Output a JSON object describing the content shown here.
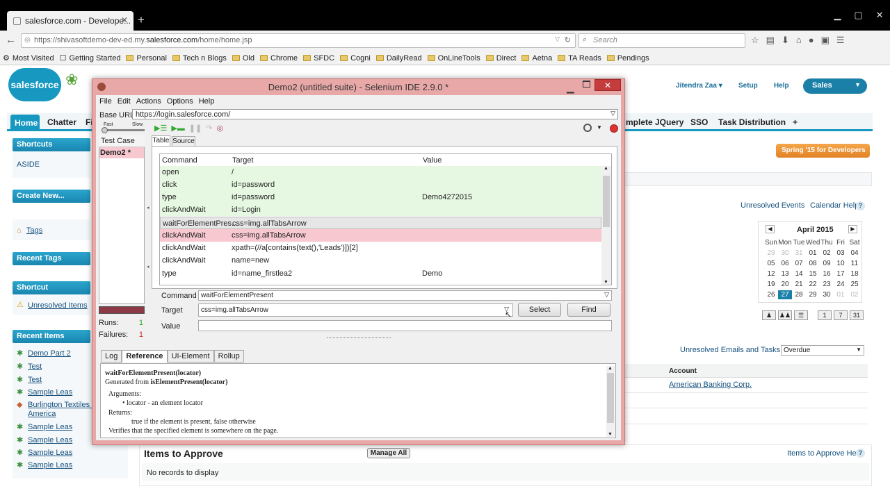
{
  "browser": {
    "tab_title": "salesforce.com - Develope...",
    "tab_close": "✕",
    "new_tab": "+",
    "url_prefix": "https://shivasoftdemo-dev-ed.my.",
    "url_domain": "salesforce.com",
    "url_suffix": "/home/home.jsp",
    "search_placeholder": "Search",
    "bookmarks": [
      "Most Visited",
      "Getting Started",
      "Personal",
      "Tech n Blogs",
      "Old",
      "Chrome",
      "SFDC",
      "Cogni",
      "DailyRead",
      "OnLineTools",
      "Direct",
      "Aetna",
      "TA Reads",
      "Pendings"
    ]
  },
  "salesforce": {
    "logo": "salesforce",
    "user_menu": "Jitendra Zaa",
    "setup": "Setup",
    "help": "Help",
    "app_menu": "Sales",
    "tabs": [
      "Home",
      "Chatter",
      "Fi",
      "mplete JQuery",
      "SSO",
      "Task Distribution",
      "+"
    ],
    "sidebar": {
      "shortcuts": "Shortcuts",
      "aside": "ASIDE",
      "create_new": "Create New...",
      "tags": "Tags",
      "recent_tags": "Recent Tags",
      "shortcut": "Shortcut",
      "unresolved_items": "Unresolved Items",
      "recent_items": "Recent Items",
      "items": [
        "Demo Part 2",
        "Test",
        "Test",
        "Sample Leas",
        "Burlington Textiles Co",
        "America",
        "Sample Leas",
        "Sample Leas",
        "Sample Leas",
        "Sample Leas"
      ]
    },
    "spring_button": "Spring '15 for Developers",
    "unresolved_events": "Unresolved Events",
    "calendar_help": "Calendar Help",
    "calendar": {
      "month": "April 2015",
      "days_header": [
        "Sun",
        "Mon",
        "Tue",
        "Wed",
        "Thu",
        "Fri",
        "Sat"
      ],
      "weeks": [
        [
          "29",
          "30",
          "31",
          "01",
          "02",
          "03",
          "04"
        ],
        [
          "05",
          "06",
          "07",
          "08",
          "09",
          "10",
          "11"
        ],
        [
          "12",
          "13",
          "14",
          "15",
          "16",
          "17",
          "18"
        ],
        [
          "19",
          "20",
          "21",
          "22",
          "23",
          "24",
          "25"
        ],
        [
          "26",
          "27",
          "28",
          "29",
          "30",
          "01",
          "02"
        ]
      ],
      "today": "27",
      "views": [
        "1",
        "7",
        "31"
      ]
    },
    "unresolved_emails": "Unresolved Emails and Tasks",
    "overdue": "Overdue",
    "account_header": "Account",
    "account_value": "American Banking Corp.",
    "items_to_approve": "Items to Approve",
    "manage_all": "Manage All",
    "items_help": "Items to Approve Help",
    "no_records": "No records to display"
  },
  "selenium": {
    "title": "Demo2 (untitled suite) - Selenium IDE 2.9.0 *",
    "menu": [
      "File",
      "Edit",
      "Actions",
      "Options",
      "Help"
    ],
    "base_url_label": "Base URL",
    "base_url": "https://login.salesforce.com/",
    "speed_fast": "Fast",
    "speed_slow": "Slow",
    "test_case_header": "Test Case",
    "test_case": "Demo2 *",
    "runs_label": "Runs:",
    "runs": "1",
    "failures_label": "Failures:",
    "failures": "1",
    "tab_table": "Table",
    "tab_source": "Source",
    "columns": [
      "Command",
      "Target",
      "Value"
    ],
    "rows": [
      {
        "command": "open",
        "target": "/",
        "value": ""
      },
      {
        "command": "click",
        "target": "id=password",
        "value": ""
      },
      {
        "command": "type",
        "target": "id=password",
        "value": "Demo4272015"
      },
      {
        "command": "clickAndWait",
        "target": "id=Login",
        "value": ""
      },
      {
        "command": "waitForElementPres...",
        "target": "css=img.allTabsArrow",
        "value": ""
      },
      {
        "command": "clickAndWait",
        "target": "css=img.allTabsArrow",
        "value": ""
      },
      {
        "command": "clickAndWait",
        "target": "xpath=(//a[contains(text(),'Leads')])[2]",
        "value": ""
      },
      {
        "command": "clickAndWait",
        "target": "name=new",
        "value": ""
      },
      {
        "command": "type",
        "target": "id=name_firstlea2",
        "value": "Demo"
      }
    ],
    "command_label": "Command",
    "command_value": "waitForElementPresent",
    "target_label": "Target",
    "target_value": "css=img.allTabsArrow",
    "value_label": "Value",
    "select_button": "Select",
    "find_button": "Find",
    "bottom_tabs": [
      "Log",
      "Reference",
      "UI-Element",
      "Rollup"
    ],
    "reference": {
      "signature": "waitForElementPresent(locator)",
      "generated_prefix": "Generated from ",
      "generated_from": "isElementPresent(locator)",
      "arguments_label": "Arguments:",
      "argument": "locator - an element locator",
      "returns_label": "Returns:",
      "returns": "true if the element is present, false otherwise",
      "description": "Verifies that the specified element is somewhere on the page."
    }
  }
}
